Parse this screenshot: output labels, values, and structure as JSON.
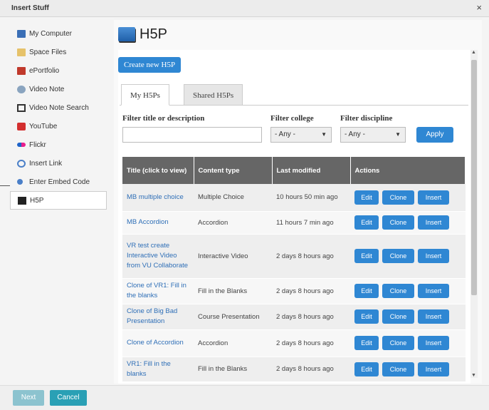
{
  "window": {
    "title": "Insert Stuff",
    "close_glyph": "×"
  },
  "sidebar": {
    "items": [
      {
        "label": "My Computer",
        "icon": "computer-icon",
        "color": "#3b6fb6"
      },
      {
        "label": "Space Files",
        "icon": "folder-icon",
        "color": "#e6c26a"
      },
      {
        "label": "ePortfolio",
        "icon": "portfolio-icon",
        "color": "#c0392b"
      },
      {
        "label": "Video Note",
        "icon": "video-note-icon",
        "color": "#8aa4bf"
      },
      {
        "label": "Video Note Search",
        "icon": "video-search-icon",
        "color": "#333333"
      },
      {
        "label": "YouTube",
        "icon": "youtube-icon",
        "color": "#d32f2f"
      },
      {
        "label": "Flickr",
        "icon": "flickr-icon",
        "color": "#1e63c8"
      },
      {
        "label": "Insert Link",
        "icon": "link-icon",
        "color": "#4a7fc8"
      },
      {
        "label": "Enter Embed Code",
        "icon": "embed-icon",
        "color": "#4a7fc8"
      },
      {
        "label": "H5P",
        "icon": "h5p-icon",
        "color": "#222222"
      }
    ]
  },
  "main": {
    "title": "H5P",
    "create_button": "Create new H5P",
    "tabs": [
      {
        "label": "My H5Ps"
      },
      {
        "label": "Shared H5Ps"
      }
    ],
    "filters": {
      "title_label": "Filter title or description",
      "college_label": "Filter college",
      "college_value": "- Any -",
      "discipline_label": "Filter discipline",
      "discipline_value": "- Any -",
      "apply_label": "Apply"
    },
    "table": {
      "headers": [
        "Title (click to view)",
        "Content type",
        "Last modified",
        "Actions"
      ],
      "rows": [
        {
          "title": "MB multiple choice",
          "type": "Multiple Choice",
          "modified": "10 hours 50 min ago"
        },
        {
          "title": "MB Accordion",
          "type": "Accordion",
          "modified": "11 hours 7 min ago"
        },
        {
          "title": "VR test create Interactive Video from VU Collaborate",
          "type": "Interactive Video",
          "modified": "2 days 8 hours ago"
        },
        {
          "title": "Clone of VR1: Fill in the blanks",
          "type": "Fill in the Blanks",
          "modified": "2 days 8 hours ago"
        },
        {
          "title": "Clone of Big Bad Presentation",
          "type": "Course Presentation",
          "modified": "2 days 8 hours ago"
        },
        {
          "title": "Clone of Accordion",
          "type": "Accordion",
          "modified": "2 days 8 hours ago"
        },
        {
          "title": "VR1: Fill in the blanks",
          "type": "Fill in the Blanks",
          "modified": "2 days 8 hours ago"
        }
      ],
      "actions": {
        "edit": "Edit",
        "clone": "Clone",
        "insert": "Insert"
      }
    }
  },
  "footer": {
    "next_label": "Next",
    "cancel_label": "Cancel"
  },
  "colors": {
    "accent": "#2f87d3",
    "header_bg": "#666666",
    "cancel": "#2aa0b5",
    "next_disabled": "#8cc3cf"
  }
}
